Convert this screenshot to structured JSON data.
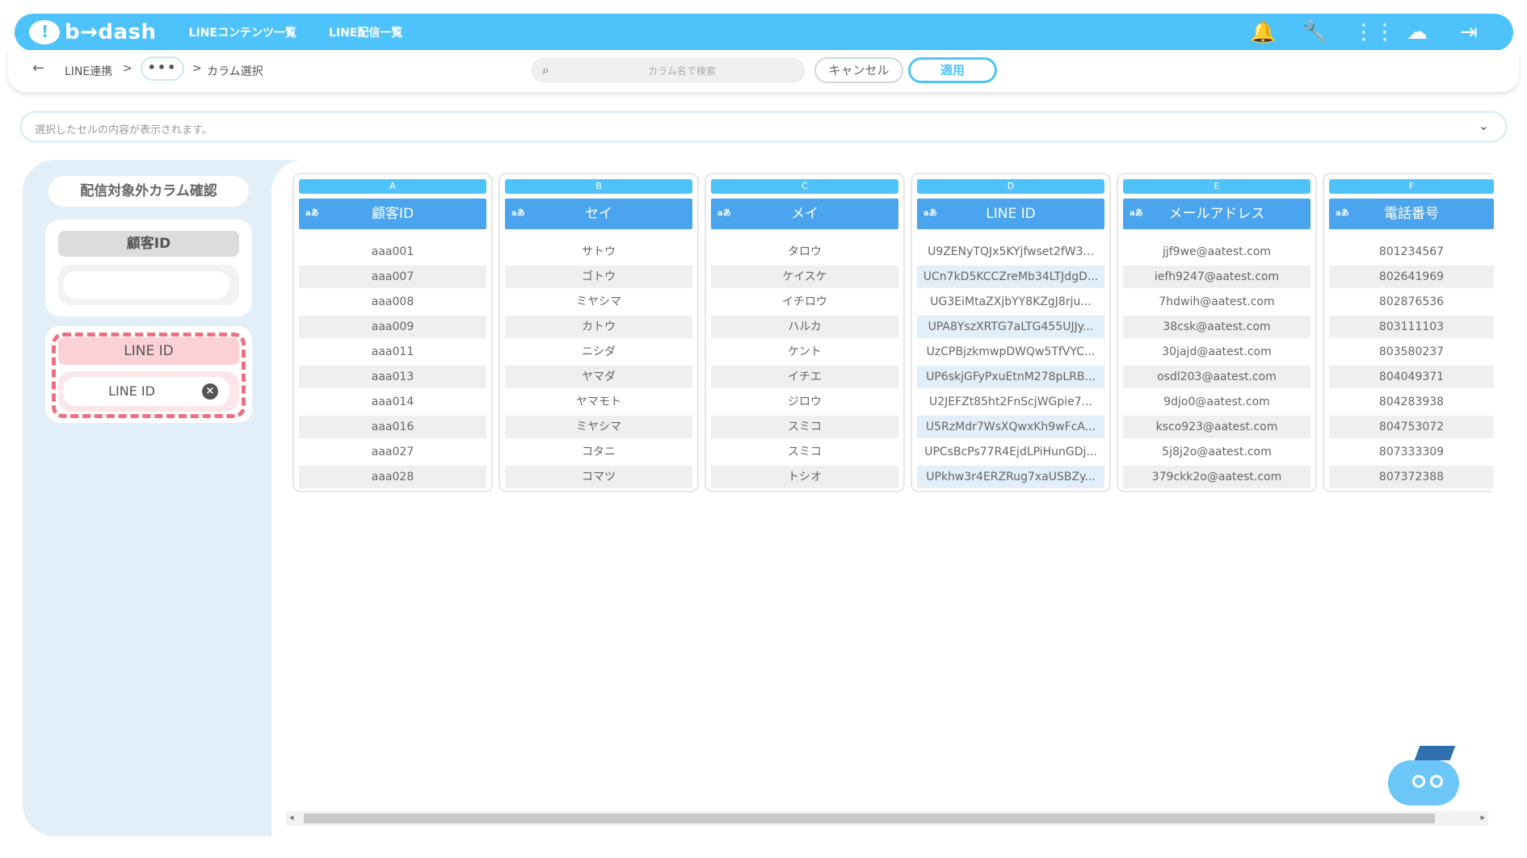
{
  "header": {
    "logo_text": "b→dash",
    "nav": [
      "LINEコンテンツ一覧",
      "LINE配信一覧"
    ],
    "icons": [
      "bell-icon",
      "wrench-icon",
      "grid-icon",
      "support-icon",
      "logout-icon"
    ]
  },
  "breadcrumb": {
    "items": [
      "LINE連携",
      "•••",
      "カラム選択"
    ],
    "separator": ">"
  },
  "search": {
    "placeholder": "カラム名で検索"
  },
  "buttons": {
    "cancel": "キャンセル",
    "apply": "適用"
  },
  "cell_preview": {
    "placeholder": "選択したセルの内容が表示されます。"
  },
  "left_panel": {
    "title": "配信対象外カラム確認",
    "cards": [
      {
        "label": "顧客ID",
        "value": ""
      },
      {
        "label": "LINE ID",
        "value": "LINE ID"
      }
    ]
  },
  "table": {
    "type_label": "aあ",
    "columns": [
      {
        "letter": "A",
        "name": "顧客ID",
        "rows": [
          "aaa001",
          "aaa007",
          "aaa008",
          "aaa009",
          "aaa011",
          "aaa013",
          "aaa014",
          "aaa016",
          "aaa027",
          "aaa028"
        ]
      },
      {
        "letter": "B",
        "name": "セイ",
        "rows": [
          "サトウ",
          "ゴトウ",
          "ミヤシマ",
          "カトウ",
          "ニシダ",
          "ヤマダ",
          "ヤマモト",
          "ミヤシマ",
          "コタニ",
          "コマツ"
        ]
      },
      {
        "letter": "C",
        "name": "メイ",
        "rows": [
          "タロウ",
          "ケイスケ",
          "イチロウ",
          "ハルカ",
          "ケント",
          "イチエ",
          "ジロウ",
          "スミコ",
          "スミコ",
          "トシオ"
        ]
      },
      {
        "letter": "D",
        "name": "LINE ID",
        "rows": [
          "U9ZENyTQJx5KYjfwset2fW3...",
          "UCn7kD5KCCZreMb34LTJdgD...",
          "UG3EiMtaZXjbYY8KZgJ8rju...",
          "UPA8YszXRTG7aLTG455UJJy...",
          "UzCPBjzkmwpDWQw5TfVYC...",
          "UP6skjGFyPxuEtnM278pLRB...",
          "U2JEFZt85ht2FnScjWGpie7...",
          "U5RzMdr7WsXQwxKh9wFcA...",
          "UPCsBcPs77R4EjdLPiHunGDj...",
          "UPkhw3r4ERZRug7xaUSBZy..."
        ]
      },
      {
        "letter": "E",
        "name": "メールアドレス",
        "rows": [
          "jjf9we@aatest.com",
          "iefh9247@aatest.com",
          "7hdwih@aatest.com",
          "38csk@aatest.com",
          "30jajd@aatest.com",
          "osdl203@aatest.com",
          "9djo0@aatest.com",
          "ksco923@aatest.com",
          "5j8j2o@aatest.com",
          "379ckk2o@aatest.com"
        ]
      },
      {
        "letter": "F",
        "name": "電話番号",
        "rows": [
          "801234567",
          "802641969",
          "802876536",
          "803111103",
          "803580237",
          "804049371",
          "804283938",
          "804753072",
          "807333309",
          "807372388"
        ]
      }
    ]
  }
}
